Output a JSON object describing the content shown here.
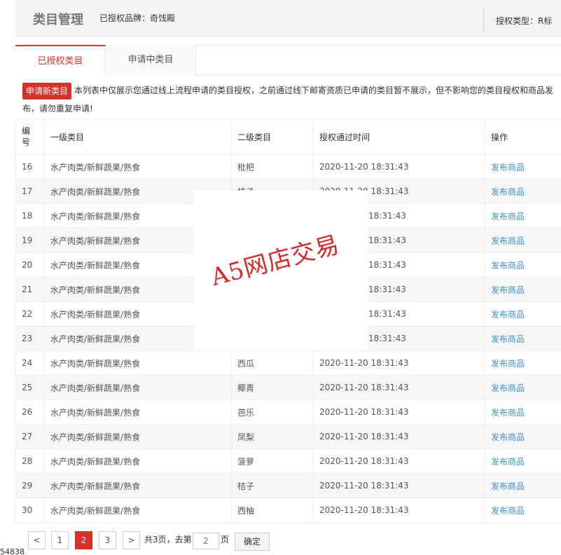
{
  "header": {
    "title": "类目管理",
    "brand_text": "已授权品牌：奇饯殿",
    "auth_type_text": "授权类型：R标"
  },
  "tabs": [
    {
      "label": "已授权类目"
    },
    {
      "label": "申请中类目"
    }
  ],
  "notice": {
    "button_label": "申请新类目",
    "text": "本列表中仅展示您通过线上流程申请的类目授权，之前通过线下邮寄资质已申请的类目暂不展示，但不影响您的类目授权和商品发布，请勿重复申请!"
  },
  "table": {
    "columns": [
      "编号",
      "一级类目",
      "二级类目",
      "授权通过时间",
      "操作"
    ],
    "rows": [
      {
        "id": "16",
        "cat1": "水产肉类/新鲜蔬果/熟食",
        "cat2": "枇杷",
        "time": "2020-11-20 18:31:43",
        "action": "发布商品"
      },
      {
        "id": "17",
        "cat1": "水产肉类/新鲜蔬果/熟食",
        "cat2": "柿子",
        "time": "2020-11-20 18:31:43",
        "action": "发布商品"
      },
      {
        "id": "18",
        "cat1": "水产肉类/新鲜蔬果/熟食",
        "cat2": "",
        "time": "18:31:43",
        "action": "发布商品"
      },
      {
        "id": "19",
        "cat1": "水产肉类/新鲜蔬果/熟食",
        "cat2": "",
        "time": "18:31:43",
        "action": "发布商品"
      },
      {
        "id": "20",
        "cat1": "水产肉类/新鲜蔬果/熟食",
        "cat2": "",
        "time": "18:31:43",
        "action": "发布商品"
      },
      {
        "id": "21",
        "cat1": "水产肉类/新鲜蔬果/熟食",
        "cat2": "",
        "time": "18:31:43",
        "action": "发布商品"
      },
      {
        "id": "22",
        "cat1": "水产肉类/新鲜蔬果/熟食",
        "cat2": "",
        "time": "18:31:43",
        "action": "发布商品"
      },
      {
        "id": "23",
        "cat1": "水产肉类/新鲜蔬果/熟食",
        "cat2": "",
        "time": "18:31:43",
        "action": "发布商品"
      },
      {
        "id": "24",
        "cat1": "水产肉类/新鲜蔬果/熟食",
        "cat2": "西瓜",
        "time": "2020-11-20 18:31:43",
        "action": "发布商品"
      },
      {
        "id": "25",
        "cat1": "水产肉类/新鲜蔬果/熟食",
        "cat2": "椰青",
        "time": "2020-11-20 18:31:43",
        "action": "发布商品"
      },
      {
        "id": "26",
        "cat1": "水产肉类/新鲜蔬果/熟食",
        "cat2": "芭乐",
        "time": "2020-11-20 18:31:43",
        "action": "发布商品"
      },
      {
        "id": "27",
        "cat1": "水产肉类/新鲜蔬果/熟食",
        "cat2": "凤梨",
        "time": "2020-11-20 18:31:43",
        "action": "发布商品"
      },
      {
        "id": "28",
        "cat1": "水产肉类/新鲜蔬果/熟食",
        "cat2": "菠萝",
        "time": "2020-11-20 18:31:43",
        "action": "发布商品"
      },
      {
        "id": "29",
        "cat1": "水产肉类/新鲜蔬果/熟食",
        "cat2": "桔子",
        "time": "2020-11-20 18:31:43",
        "action": "发布商品"
      },
      {
        "id": "30",
        "cat1": "水产肉类/新鲜蔬果/熟食",
        "cat2": "西柚",
        "time": "2020-11-20 18:31:43",
        "action": "发布商品"
      }
    ]
  },
  "pagination": {
    "prev": "<",
    "pages": [
      "1",
      "2",
      "3"
    ],
    "current": "2",
    "next": ">",
    "total_text": "共3页，去第",
    "input_value": "2",
    "page_suffix": "页",
    "confirm_label": "确定"
  },
  "footer": {
    "id_text": "54838"
  },
  "watermark": {
    "text": "A5网店交易"
  }
}
